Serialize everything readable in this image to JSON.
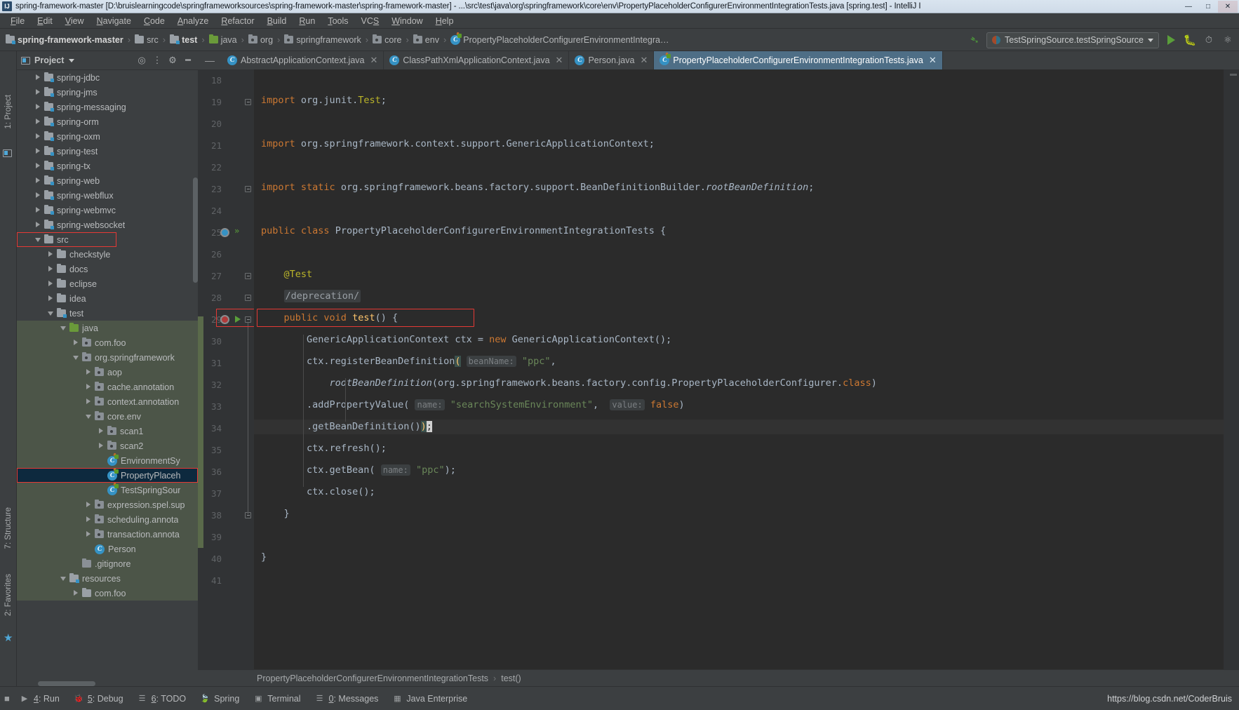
{
  "window": {
    "title": "spring-framework-master [D:\\bruislearningcode\\springframeworksources\\spring-framework-master\\spring-framework-master] - ...\\src\\test\\java\\org\\springframework\\core\\env\\PropertyPlaceholderConfigurerEnvironmentIntegrationTests.java [spring.test] - IntelliJ I",
    "logo": "IJ",
    "buttons": {
      "minimize": "—",
      "maximize": "□",
      "close": "✕"
    }
  },
  "menu": {
    "items": [
      {
        "label": "File",
        "mnemonic": "F"
      },
      {
        "label": "Edit",
        "mnemonic": "E"
      },
      {
        "label": "View",
        "mnemonic": "V"
      },
      {
        "label": "Navigate",
        "mnemonic": "N"
      },
      {
        "label": "Code",
        "mnemonic": "C"
      },
      {
        "label": "Analyze",
        "mnemonic": "A"
      },
      {
        "label": "Refactor",
        "mnemonic": "R"
      },
      {
        "label": "Build",
        "mnemonic": "B"
      },
      {
        "label": "Run",
        "mnemonic": "R"
      },
      {
        "label": "Tools",
        "mnemonic": "T"
      },
      {
        "label": "VCS",
        "mnemonic": "S"
      },
      {
        "label": "Window",
        "mnemonic": "W"
      },
      {
        "label": "Help",
        "mnemonic": "H"
      }
    ]
  },
  "navbar": {
    "crumbs": [
      {
        "label": "spring-framework-master",
        "icon": "folder-module-icon",
        "bold": true
      },
      {
        "label": "src",
        "icon": "folder-icon",
        "bold": false
      },
      {
        "label": "test",
        "icon": "folder-module-icon",
        "bold": true
      },
      {
        "label": "java",
        "icon": "folder-source-root-icon",
        "bold": false
      },
      {
        "label": "org",
        "icon": "package-icon",
        "bold": false
      },
      {
        "label": "springframework",
        "icon": "package-icon",
        "bold": false
      },
      {
        "label": "core",
        "icon": "package-icon",
        "bold": false
      },
      {
        "label": "env",
        "icon": "package-icon",
        "bold": false
      },
      {
        "label": "PropertyPlaceholderConfigurerEnvironmentIntegra…",
        "icon": "test-class-icon",
        "bold": false
      }
    ],
    "separator": "›",
    "run_configuration": "TestSpringSource.testSpringSource",
    "toolbar_icons": [
      "build-hammer-icon",
      "run-icon",
      "debug-icon",
      "run-with-coverage-icon",
      "profile-icon"
    ]
  },
  "project_panel": {
    "title": "Project",
    "header_icons": [
      "locate-icon",
      "collapse-all-icon",
      "settings-gear-icon",
      "hide-icon"
    ],
    "tree": [
      {
        "label": "spring-jdbc",
        "depth": 1,
        "icon": "folder-module-icon",
        "arrow": "right",
        "state": "normal"
      },
      {
        "label": "spring-jms",
        "depth": 1,
        "icon": "folder-module-icon",
        "arrow": "right",
        "state": "normal"
      },
      {
        "label": "spring-messaging",
        "depth": 1,
        "icon": "folder-module-icon",
        "arrow": "right",
        "state": "normal"
      },
      {
        "label": "spring-orm",
        "depth": 1,
        "icon": "folder-module-icon",
        "arrow": "right",
        "state": "normal"
      },
      {
        "label": "spring-oxm",
        "depth": 1,
        "icon": "folder-module-icon",
        "arrow": "right",
        "state": "normal"
      },
      {
        "label": "spring-test",
        "depth": 1,
        "icon": "folder-module-icon",
        "arrow": "right",
        "state": "normal"
      },
      {
        "label": "spring-tx",
        "depth": 1,
        "icon": "folder-module-icon",
        "arrow": "right",
        "state": "normal"
      },
      {
        "label": "spring-web",
        "depth": 1,
        "icon": "folder-module-icon",
        "arrow": "right",
        "state": "normal"
      },
      {
        "label": "spring-webflux",
        "depth": 1,
        "icon": "folder-module-icon",
        "arrow": "right",
        "state": "normal"
      },
      {
        "label": "spring-webmvc",
        "depth": 1,
        "icon": "folder-module-icon",
        "arrow": "right",
        "state": "normal"
      },
      {
        "label": "spring-websocket",
        "depth": 1,
        "icon": "folder-module-icon",
        "arrow": "right",
        "state": "normal"
      },
      {
        "label": "src",
        "depth": 1,
        "icon": "folder-icon",
        "arrow": "down",
        "state": "highlighted"
      },
      {
        "label": "checkstyle",
        "depth": 2,
        "icon": "folder-icon",
        "arrow": "right",
        "state": "normal"
      },
      {
        "label": "docs",
        "depth": 2,
        "icon": "folder-icon",
        "arrow": "right",
        "state": "normal"
      },
      {
        "label": "eclipse",
        "depth": 2,
        "icon": "folder-icon",
        "arrow": "right",
        "state": "normal"
      },
      {
        "label": "idea",
        "depth": 2,
        "icon": "folder-icon",
        "arrow": "right",
        "state": "normal"
      },
      {
        "label": "test",
        "depth": 2,
        "icon": "folder-module-icon",
        "arrow": "down",
        "state": "normal"
      },
      {
        "label": "java",
        "depth": 3,
        "icon": "folder-source-root-icon",
        "arrow": "down",
        "state": "source-root"
      },
      {
        "label": "com.foo",
        "depth": 4,
        "icon": "package-icon",
        "arrow": "right",
        "state": "source-root"
      },
      {
        "label": "org.springframework",
        "depth": 4,
        "icon": "package-icon",
        "arrow": "down",
        "state": "source-root"
      },
      {
        "label": "aop",
        "depth": 5,
        "icon": "package-icon",
        "arrow": "right",
        "state": "source-root"
      },
      {
        "label": "cache.annotation",
        "depth": 5,
        "icon": "package-icon",
        "arrow": "right",
        "state": "source-root"
      },
      {
        "label": "context.annotation",
        "depth": 5,
        "icon": "package-icon",
        "arrow": "right",
        "state": "source-root"
      },
      {
        "label": "core.env",
        "depth": 5,
        "icon": "package-icon",
        "arrow": "down",
        "state": "source-root"
      },
      {
        "label": "scan1",
        "depth": 6,
        "icon": "package-icon",
        "arrow": "right",
        "state": "source-root"
      },
      {
        "label": "scan2",
        "depth": 6,
        "icon": "package-icon",
        "arrow": "right",
        "state": "source-root"
      },
      {
        "label": "EnvironmentSy",
        "depth": 6,
        "icon": "test-class-icon",
        "arrow": "none",
        "state": "source-root"
      },
      {
        "label": "PropertyPlaceh",
        "depth": 6,
        "icon": "test-class-icon",
        "arrow": "none",
        "state": "selected"
      },
      {
        "label": "TestSpringSour",
        "depth": 6,
        "icon": "test-class-icon",
        "arrow": "none",
        "state": "source-root"
      },
      {
        "label": "expression.spel.sup",
        "depth": 5,
        "icon": "package-icon",
        "arrow": "right",
        "state": "source-root"
      },
      {
        "label": "scheduling.annota",
        "depth": 5,
        "icon": "package-icon",
        "arrow": "right",
        "state": "source-root"
      },
      {
        "label": "transaction.annota",
        "depth": 5,
        "icon": "package-icon",
        "arrow": "right",
        "state": "source-root"
      },
      {
        "label": "Person",
        "depth": 5,
        "icon": "class-icon",
        "arrow": "none",
        "state": "source-root"
      },
      {
        "label": ".gitignore",
        "depth": 4,
        "icon": "file-icon",
        "arrow": "none",
        "state": "source-root"
      },
      {
        "label": "resources",
        "depth": 3,
        "icon": "folder-resource-icon",
        "arrow": "down",
        "state": "source-root"
      },
      {
        "label": "com.foo",
        "depth": 4,
        "icon": "folder-icon",
        "arrow": "right",
        "state": "source-root"
      }
    ]
  },
  "editor": {
    "tabs": [
      {
        "label": "AbstractApplicationContext.java",
        "icon": "class-icon",
        "active": false,
        "closable": true
      },
      {
        "label": "ClassPathXmlApplicationContext.java",
        "icon": "class-icon",
        "active": false,
        "closable": true
      },
      {
        "label": "Person.java",
        "icon": "class-icon",
        "active": false,
        "closable": true
      },
      {
        "label": "PropertyPlaceholderConfigurerEnvironmentIntegrationTests.java",
        "icon": "test-class-icon",
        "active": true,
        "closable": true
      }
    ],
    "first_line_number": 18,
    "lines": [
      {
        "n": 18,
        "text": ""
      },
      {
        "n": 19,
        "text": "import org.junit.Test;"
      },
      {
        "n": 20,
        "text": ""
      },
      {
        "n": 21,
        "text": "import org.springframework.context.support.GenericApplicationContext;"
      },
      {
        "n": 22,
        "text": ""
      },
      {
        "n": 23,
        "text": "import static org.springframework.beans.factory.support.BeanDefinitionBuilder.rootBeanDefinition;"
      },
      {
        "n": 24,
        "text": ""
      },
      {
        "n": 25,
        "text": "public class PropertyPlaceholderConfigurerEnvironmentIntegrationTests {"
      },
      {
        "n": 26,
        "text": ""
      },
      {
        "n": 27,
        "text": "    @Test"
      },
      {
        "n": 28,
        "text": "    /deprecation/"
      },
      {
        "n": 29,
        "text": "    public void test() {"
      },
      {
        "n": 30,
        "text": "        GenericApplicationContext ctx = new GenericApplicationContext();"
      },
      {
        "n": 31,
        "text": "        ctx.registerBeanDefinition( beanName: \"ppc\","
      },
      {
        "n": 32,
        "text": "            rootBeanDefinition(org.springframework.beans.factory.config.PropertyPlaceholderConfigurer.class)"
      },
      {
        "n": 33,
        "text": "            .addPropertyValue( name: \"searchSystemEnvironment\",  value: false)"
      },
      {
        "n": 34,
        "text": "            .getBeanDefinition());"
      },
      {
        "n": 35,
        "text": "        ctx.refresh();"
      },
      {
        "n": 36,
        "text": "        ctx.getBean( name: \"ppc\");"
      },
      {
        "n": 37,
        "text": "        ctx.close();"
      },
      {
        "n": 38,
        "text": "    }"
      },
      {
        "n": 39,
        "text": ""
      },
      {
        "n": 40,
        "text": "}"
      },
      {
        "n": 41,
        "text": ""
      }
    ],
    "parameter_hints": [
      "beanName:",
      "name:",
      "value:"
    ],
    "caret_line": 34,
    "folded_comment": "/deprecation/",
    "breadcrumb": {
      "class": "PropertyPlaceholderConfigurerEnvironmentIntegrationTests",
      "separator": "›",
      "method": "test()"
    }
  },
  "tool_windows": {
    "left_rail": [
      {
        "label": "1: Project",
        "icon": "project-icon"
      },
      {
        "label": "7: Structure",
        "icon": "structure-icon"
      },
      {
        "label": "2: Favorites",
        "icon": "favorites-star-icon"
      }
    ],
    "bottom": [
      {
        "label": "4: Run",
        "mnemonic": "4",
        "icon": "run-play-icon"
      },
      {
        "label": "5: Debug",
        "mnemonic": "5",
        "icon": "debug-bug-icon"
      },
      {
        "label": "6: TODO",
        "mnemonic": "6",
        "icon": "todo-list-icon"
      },
      {
        "label": "Spring",
        "mnemonic": "",
        "icon": "spring-leaf-icon"
      },
      {
        "label": "Terminal",
        "mnemonic": "",
        "icon": "terminal-icon"
      },
      {
        "label": "0: Messages",
        "mnemonic": "0",
        "icon": "messages-icon"
      },
      {
        "label": "Java Enterprise",
        "mnemonic": "",
        "icon": "java-enterprise-icon"
      }
    ],
    "watermark": "https://blog.csdn.net/CoderBruis"
  },
  "colors": {
    "editor_bg": "#2b2b2b",
    "panel_bg": "#3c3f41",
    "gutter_bg": "#313335",
    "source_root_bg": "#4c5548",
    "selection_bg": "#0d293e",
    "tab_active_bg": "#4e6e86",
    "annotation_red": "#e53935",
    "keyword": "#cc7832",
    "string": "#6a8759",
    "annotation_yellow": "#bbb529",
    "identifier": "#a9b7c6",
    "number": "#6897bb",
    "hint": "#7b7f82"
  }
}
